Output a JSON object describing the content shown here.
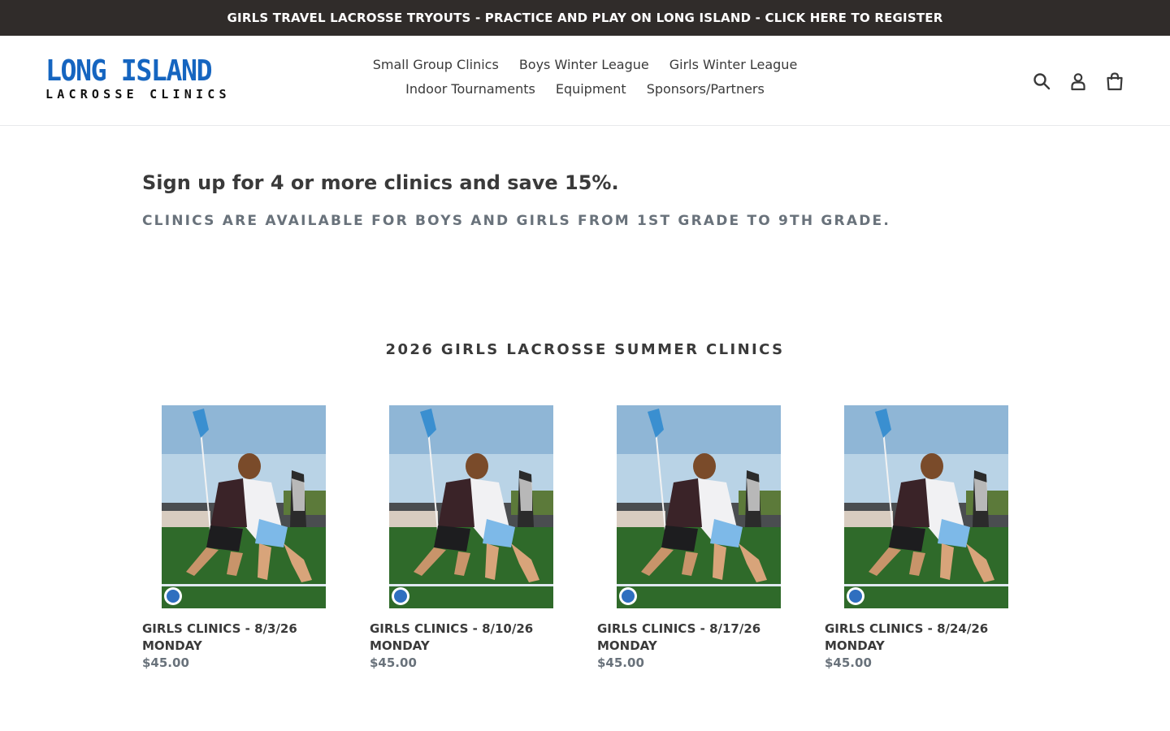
{
  "announcement": {
    "text": "GIRLS TRAVEL LACROSSE TRYOUTS - PRACTICE AND PLAY ON LONG ISLAND - CLICK HERE TO REGISTER"
  },
  "logo": {
    "line1": "LONG ISLAND",
    "line2": "LACROSSE CLINICS"
  },
  "nav": {
    "row1": [
      "Small Group Clinics",
      "Boys Winter League",
      "Girls Winter League"
    ],
    "row2": [
      "Indoor Tournaments",
      "Equipment",
      "Sponsors/Partners"
    ]
  },
  "header_icons": [
    "search-icon",
    "account-icon",
    "cart-icon"
  ],
  "intro": {
    "title": "Sign up for 4 or more clinics and save 15%.",
    "subtitle": "Clinics are available for boys and girls from 1st grade to 9th grade."
  },
  "collection": {
    "title": "2026 GIRLS LACROSSE SUMMER CLINICS",
    "products": [
      {
        "title": "GIRLS CLINICS - 8/3/26 MONDAY",
        "price": "$45.00"
      },
      {
        "title": "GIRLS CLINICS - 8/10/26 MONDAY",
        "price": "$45.00"
      },
      {
        "title": "GIRLS CLINICS - 8/17/26 MONDAY",
        "price": "$45.00"
      },
      {
        "title": "GIRLS CLINICS - 8/24/26 MONDAY",
        "price": "$45.00"
      }
    ]
  },
  "colors": {
    "announcement_bg": "#302c2a",
    "logo_blue": "#1565c0",
    "text": "#3a3a3a",
    "muted": "#69727b"
  }
}
